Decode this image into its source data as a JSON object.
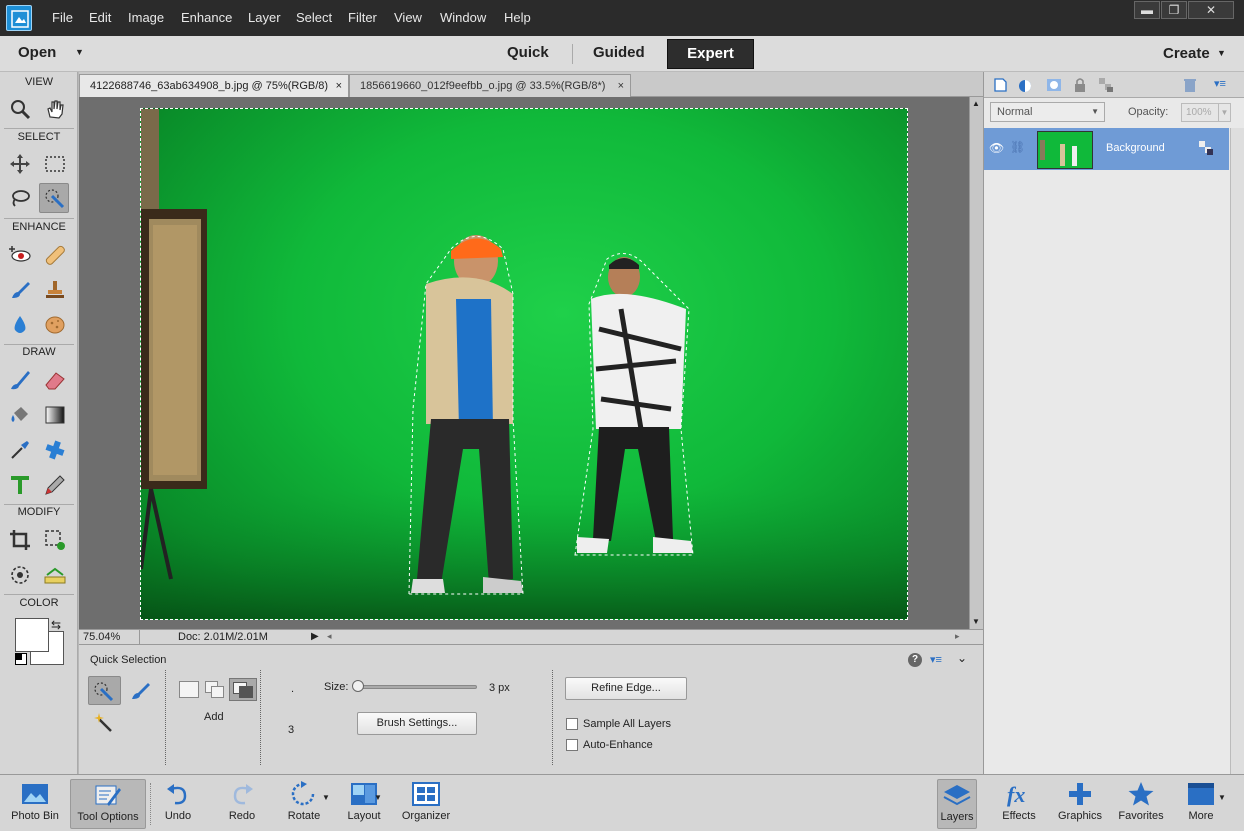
{
  "menu": [
    "File",
    "Edit",
    "Image",
    "Enhance",
    "Layer",
    "Select",
    "Filter",
    "View",
    "Window",
    "Help"
  ],
  "window_controls": {
    "minimize": "▬",
    "restore": "❐",
    "close": "✕"
  },
  "modebar": {
    "open": "Open",
    "quick": "Quick",
    "guided": "Guided",
    "expert": "Expert",
    "create": "Create"
  },
  "toolbox": {
    "view": "VIEW",
    "select": "SELECT",
    "enhance": "ENHANCE",
    "draw": "DRAW",
    "modify": "MODIFY",
    "color": "COLOR"
  },
  "tabs": [
    {
      "label": "4122688746_63ab634908_b.jpg @ 75%(RGB/8)",
      "close": "×"
    },
    {
      "label": "1856619660_012f9eefbb_o.jpg @ 33.5%(RGB/8*)",
      "close": "×"
    }
  ],
  "status": {
    "zoom": "75.04%",
    "doc": "Doc: 2.01M/2.01M"
  },
  "tool_options": {
    "title": "Quick Selection",
    "add_label": "Add",
    "dot": ".",
    "size_label": "Size:",
    "size_value": "3 px",
    "size_fraction": 0.0,
    "brush_value": "3",
    "brush_settings": "Brush Settings...",
    "refine_edge": "Refine Edge...",
    "sample_all_layers": "Sample All Layers",
    "auto_enhance": "Auto-Enhance",
    "help": "?"
  },
  "layers_panel": {
    "blend_mode": "Normal",
    "opacity_label": "Opacity:",
    "opacity_value": "100%",
    "layer_name": "Background"
  },
  "bottom": [
    "Photo Bin",
    "Tool Options",
    "Undo",
    "Redo",
    "Rotate",
    "Layout",
    "Organizer",
    "Layers",
    "Effects",
    "Graphics",
    "Favorites",
    "More"
  ],
  "colors": {
    "accent": "#6f9bd6",
    "dark": "#2b2b2b",
    "green": "#10b93a"
  }
}
